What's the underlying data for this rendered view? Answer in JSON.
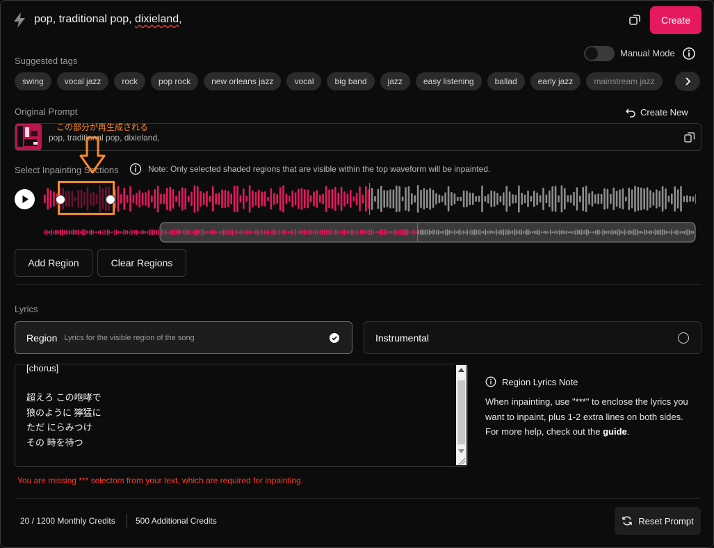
{
  "top": {
    "prompt_main": "pop, traditional pop, ",
    "prompt_underlined": "dixieland",
    "prompt_tail": ",",
    "create_label": "Create"
  },
  "tags": {
    "label": "Suggested tags",
    "manual_mode_label": "Manual Mode",
    "items": [
      "swing",
      "vocal jazz",
      "rock",
      "pop rock",
      "new orleans jazz",
      "vocal",
      "big band",
      "jazz",
      "easy listening",
      "ballad",
      "early jazz",
      "mainstream jazz"
    ]
  },
  "original_prompt": {
    "label": "Original Prompt",
    "create_new_label": "Create New",
    "text": "pop, traditional pop, dixieland,"
  },
  "annotation": {
    "text": "この部分が再生成される"
  },
  "inpainting": {
    "label": "Select Inpainting Sections",
    "note": "Note: Only selected shaded regions that are visible within the top waveform will be inpainted.",
    "add_region_label": "Add Region",
    "clear_regions_label": "Clear Regions",
    "playhead_fraction": 0.5,
    "region_fraction": [
      0.025,
      0.105
    ],
    "viewport_fraction": [
      0.18,
      1.0
    ]
  },
  "lyrics": {
    "label": "Lyrics",
    "region_title": "Region",
    "region_sub": "Lyrics for the visible region of the song",
    "instrumental_title": "Instrumental",
    "lines": [
      "[chorus]",
      "",
      "超えろ この咆哮で",
      "狼のように 獰猛に",
      "ただ にらみつけ",
      "その 時を待つ"
    ]
  },
  "note_panel": {
    "title": "Region Lyrics Note",
    "body_pre": "When inpainting, use \"***\" to enclose the lyrics you want to inpaint, plus 1-2 extra lines on both sides. For more help, check out the ",
    "guide_label": "guide",
    "body_post": "."
  },
  "error": "You are missing *** selectors from your text, which are required for inpainting.",
  "footer": {
    "monthly_credits": "20 / 1200 Monthly Credits",
    "additional_credits": "500 Additional Credits",
    "reset_label": "Reset Prompt"
  },
  "colors": {
    "accent": "#e5195f",
    "annotation": "#ff8a2a",
    "error": "#ff3b30",
    "wave_gray": "#8d8d8d"
  },
  "icons": {
    "bolt": "lightning-icon",
    "share": "copy-icon",
    "info": "info-icon",
    "undo": "undo-icon",
    "chevron": "chevron-right-icon",
    "play": "play-icon",
    "reset": "refresh-icon"
  }
}
